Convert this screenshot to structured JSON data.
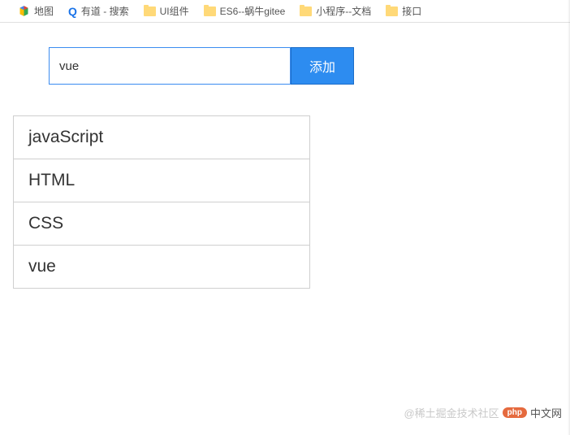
{
  "bookmarks": [
    {
      "label": "地图",
      "icon": "map"
    },
    {
      "label": "有道 - 搜索",
      "icon": "search"
    },
    {
      "label": "UI组件",
      "icon": "folder"
    },
    {
      "label": "ES6--蜗牛gitee",
      "icon": "folder"
    },
    {
      "label": "小程序--文档",
      "icon": "folder"
    },
    {
      "label": "接口",
      "icon": "folder"
    }
  ],
  "form": {
    "input_value": "vue",
    "add_label": "添加"
  },
  "items": [
    "javaScript",
    "HTML",
    "CSS",
    "vue"
  ],
  "watermark": {
    "prefix": "@稀土掘金技术社区",
    "badge": "php",
    "suffix": "中文网"
  }
}
